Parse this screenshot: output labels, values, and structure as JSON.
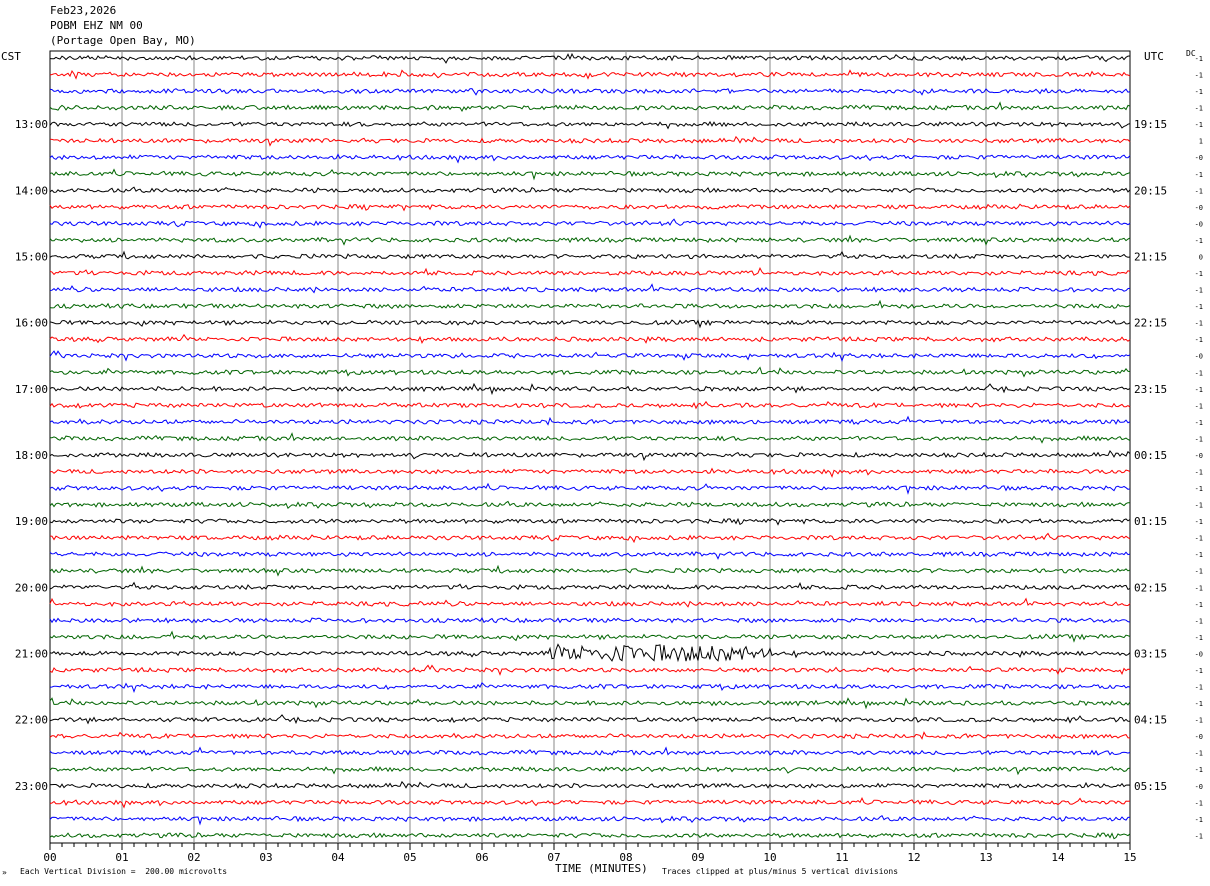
{
  "header": {
    "date": "Feb23,2026",
    "station": "POBM EHZ NM 00",
    "location": "(Portage Open Bay, MO)"
  },
  "left_label": "CST",
  "right_label": "UTC",
  "dc_label": "DC",
  "footer": {
    "division": "Each Vertical Division =  200.00 microvolts",
    "xlabel": "TIME (MINUTES)",
    "clip_note": "Traces clipped at plus/minus 5 vertical divisions",
    "corner_mark": "»"
  },
  "chart_data": {
    "type": "line",
    "title": "Feb23,2026 POBM EHZ NM 00 (Portage Open Bay, MO)",
    "xlabel": "TIME (MINUTES)",
    "xlim": [
      0,
      15
    ],
    "x_ticks": [
      "00",
      "01",
      "02",
      "03",
      "04",
      "05",
      "06",
      "07",
      "08",
      "09",
      "10",
      "11",
      "12",
      "13",
      "14",
      "15"
    ],
    "trace_minutes": 15,
    "trace_count": 48,
    "trace_colors": [
      "#000000",
      "#ff0000",
      "#0000ff",
      "#006400"
    ],
    "left_hour_labels": [
      {
        "trace": 4,
        "label": "13:00"
      },
      {
        "trace": 8,
        "label": "14:00"
      },
      {
        "trace": 12,
        "label": "15:00"
      },
      {
        "trace": 16,
        "label": "16:00"
      },
      {
        "trace": 20,
        "label": "17:00"
      },
      {
        "trace": 24,
        "label": "18:00"
      },
      {
        "trace": 28,
        "label": "19:00"
      },
      {
        "trace": 32,
        "label": "20:00"
      },
      {
        "trace": 36,
        "label": "21:00"
      },
      {
        "trace": 40,
        "label": "22:00"
      },
      {
        "trace": 44,
        "label": "23:00"
      }
    ],
    "right_hour_labels": [
      {
        "trace": 4,
        "label": "19:15"
      },
      {
        "trace": 8,
        "label": "20:15"
      },
      {
        "trace": 12,
        "label": "21:15"
      },
      {
        "trace": 16,
        "label": "22:15"
      },
      {
        "trace": 20,
        "label": "23:15"
      },
      {
        "trace": 24,
        "label": "00:15"
      },
      {
        "trace": 28,
        "label": "01:15"
      },
      {
        "trace": 32,
        "label": "02:15"
      },
      {
        "trace": 36,
        "label": "03:15"
      },
      {
        "trace": 40,
        "label": "04:15"
      },
      {
        "trace": 44,
        "label": "05:15"
      }
    ],
    "dc_offsets": [
      "-1",
      "-1",
      "-1",
      "-1",
      "-1",
      "1",
      "-0",
      "-1",
      "-1",
      "-0",
      "-0",
      "-1",
      "0",
      "-1",
      "-1",
      "-1",
      "-1",
      "-1",
      "-0",
      "-1",
      "-1",
      "-1",
      "-1",
      "-1",
      "-0",
      "-1",
      "-1",
      "-1",
      "-1",
      "-1",
      "-1",
      "-1",
      "-1",
      "-1",
      "-1",
      "-1",
      "-0",
      "-1",
      "-1",
      "-1",
      "-1",
      "-0",
      "-1",
      "-1",
      "-0",
      "-1",
      "-1",
      "-1"
    ],
    "event": {
      "trace": 36,
      "start_minute": 6.9,
      "end_minute": 10.0,
      "peak_minute": 8.3
    },
    "division_microvolts": 200.0,
    "clip_divisions": 5
  }
}
